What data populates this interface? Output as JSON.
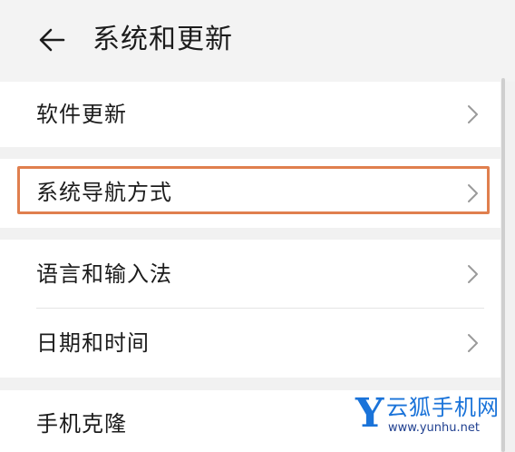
{
  "header": {
    "back_icon": "arrow-left-icon",
    "title": "系统和更新"
  },
  "settings": {
    "items": [
      {
        "label": "软件更新",
        "icon": "chevron-right-icon"
      },
      {
        "label": "系统导航方式",
        "icon": "chevron-right-icon",
        "highlighted": true
      },
      {
        "label": "语言和输入法",
        "icon": "chevron-right-icon"
      },
      {
        "label": "日期和时间",
        "icon": "chevron-right-icon"
      },
      {
        "label": "手机克隆"
      }
    ]
  },
  "watermark": {
    "logo_letter": "Y",
    "name": "云狐手机网",
    "url": "www.yunhu.net"
  },
  "colors": {
    "background": "#f1f1f1",
    "card": "#ffffff",
    "highlight": "#e07f4e",
    "watermark_blue": "#1a73d9"
  }
}
